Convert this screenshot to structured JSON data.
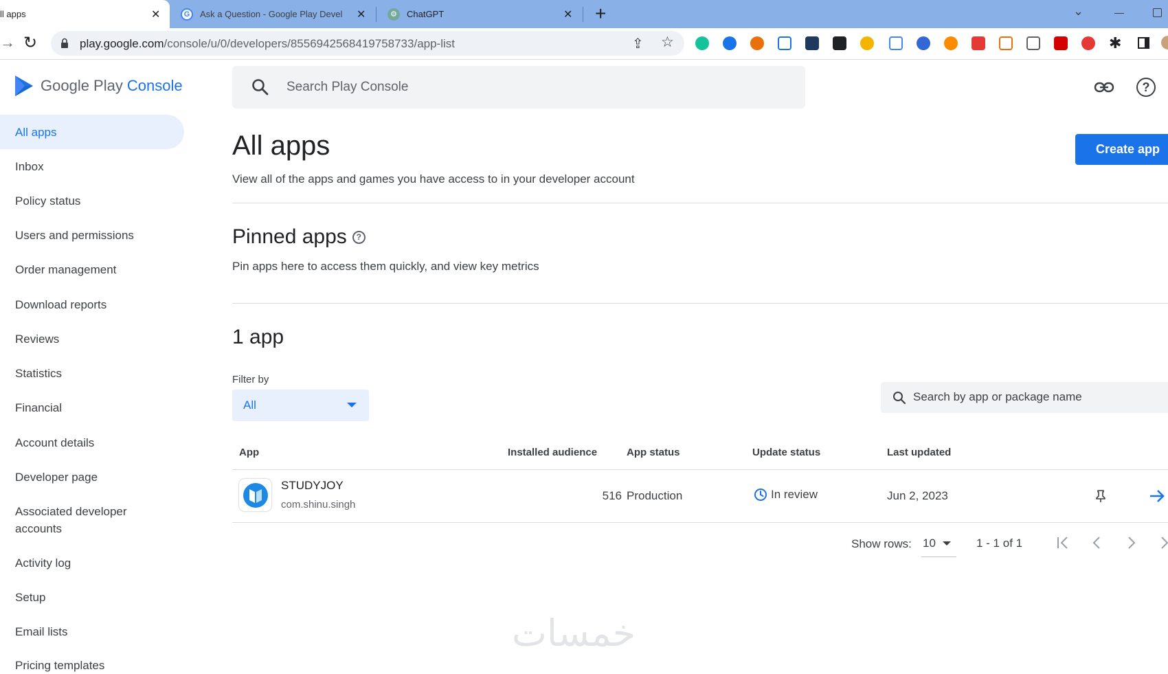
{
  "browser": {
    "tabs": [
      {
        "title": "ll apps",
        "active": true
      },
      {
        "title": "Ask a Question - Google Play Devel",
        "active": false
      },
      {
        "title": "ChatGPT",
        "active": false
      }
    ],
    "new_tab": "+",
    "url_host": "play.google.com",
    "url_path": "/console/u/0/developers/8556942568419758733/app-list"
  },
  "console": {
    "brand_google_play": "Google Play",
    "brand_console": "Console",
    "search_placeholder": "Search Play Console"
  },
  "sidebar": {
    "items": [
      {
        "label": "All apps",
        "active": true
      },
      {
        "label": "Inbox"
      },
      {
        "label": "Policy status"
      },
      {
        "label": "Users and permissions"
      },
      {
        "label": "Order management"
      },
      {
        "label": "Download reports"
      },
      {
        "label": "Reviews"
      },
      {
        "label": "Statistics"
      },
      {
        "label": "Financial"
      },
      {
        "label": "Account details"
      },
      {
        "label": "Developer page"
      },
      {
        "label": "Associated developer accounts"
      },
      {
        "label": "Activity log"
      },
      {
        "label": "Setup"
      },
      {
        "label": "Email lists"
      },
      {
        "label": "Pricing templates"
      }
    ]
  },
  "main": {
    "title": "All apps",
    "subtitle": "View all of the apps and games you have access to in your developer account",
    "create_button": "Create app",
    "pinned_title": "Pinned apps",
    "pinned_subtitle": "Pin apps here to access them quickly, and view key metrics",
    "count_title": "1 app",
    "filter_label": "Filter by",
    "filter_value": "All",
    "app_search_placeholder": "Search by app or package name",
    "table": {
      "columns": [
        "App",
        "Installed audience",
        "App status",
        "Update status",
        "Last updated"
      ],
      "rows": [
        {
          "name": "STUDYJOY",
          "package": "com.shinu.singh",
          "installed": "516",
          "status": "Production",
          "update_status": "In review",
          "last_updated": "Jun 2, 2023"
        }
      ]
    },
    "pagination": {
      "show_rows_label": "Show rows:",
      "rows_value": "10",
      "range": "1 - 1 of 1"
    }
  },
  "watermark": "خمسات",
  "colors": {
    "accent": "#1a73e8",
    "tabbar": "#8ab0e8",
    "active_nav_bg": "#e8f0fe"
  }
}
